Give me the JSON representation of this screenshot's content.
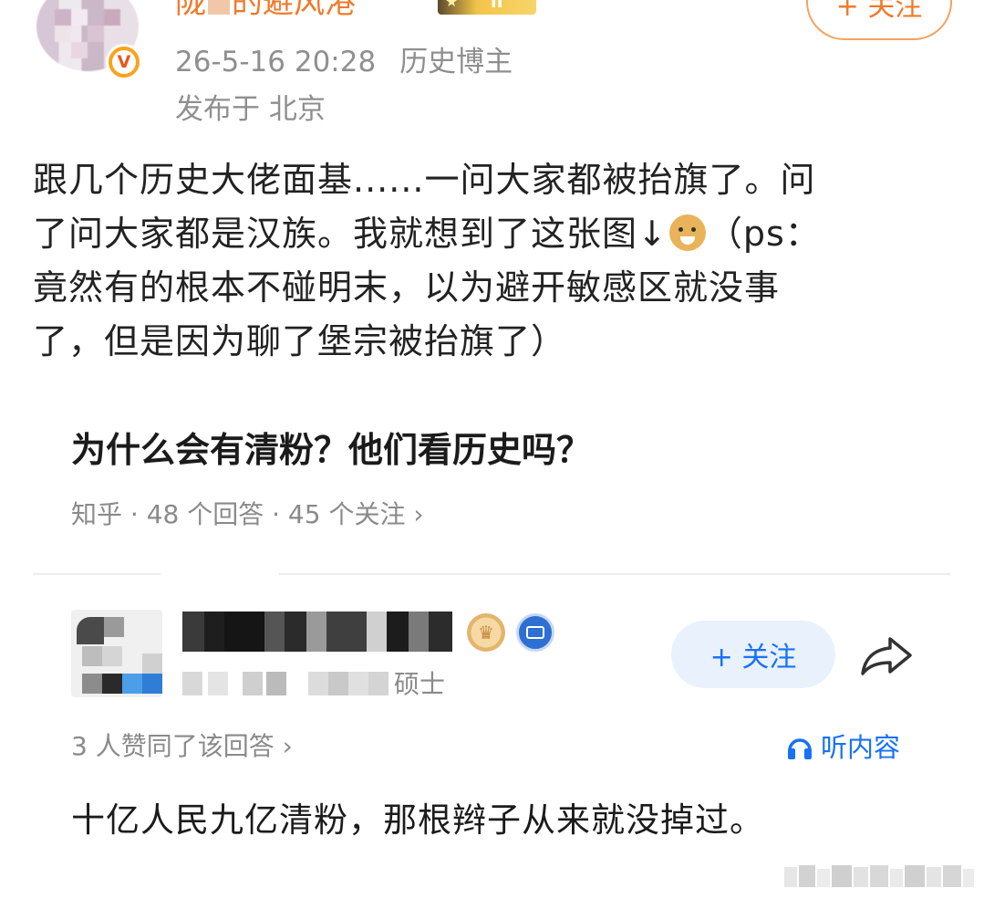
{
  "header": {
    "username_visible_prefix": "陇",
    "username_visible_suffix": "的避风港",
    "level_badge_value": "II",
    "follow_label": "+ 关注",
    "timestamp": "26-5-16 20:28",
    "user_tag": "历史博主",
    "location": "发布于 北京",
    "verified_badge": "V",
    "icons": {
      "verified": "verified-badge-icon",
      "level": "level-badge-icon"
    },
    "colors": {
      "username": "#f07a2a",
      "meta": "#8f8f8f",
      "verify": "#f9a31b"
    }
  },
  "post": {
    "lines": [
      "跟几个历史大佬面基......一问大家都被抬旗了。问",
      "了问大家都是汉族。我就想到了这张图↓",
      "竟然有的根本不碰明末，以为避开敏感区就没事",
      "了，但是因为聊了堡宗被抬旗了）"
    ],
    "line2_tail": "（ps：",
    "emoji_name": "doge-emoji-icon"
  },
  "embedded": {
    "question_title": "为什么会有清粉？他们看历史吗？",
    "question_meta": "知乎 · 48 个回答 · 45 个关注 ›",
    "answerer_degree": "硕士",
    "follow_label": "+ 关注",
    "agree_text": "3 人赞同了该回答 ›",
    "listen_label": "听内容",
    "answer_text": "十亿人民九亿清粉，那根辫子从来就没掉过。",
    "icons": {
      "crown": "crown-badge-icon",
      "certified": "certified-badge-icon",
      "share": "share-icon",
      "headphones": "headphones-icon"
    },
    "colors": {
      "accent": "#1772f6",
      "follow_bg": "#e9f1fd",
      "muted": "#8a8a8a"
    }
  }
}
